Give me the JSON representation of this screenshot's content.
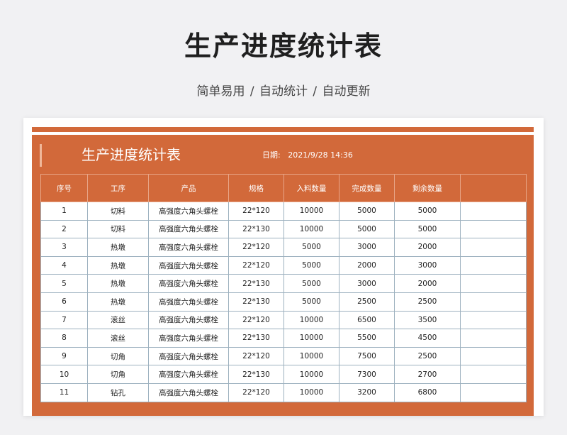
{
  "header": {
    "title": "生产进度统计表",
    "subtitle": "简单易用  /  自动统计  /  自动更新"
  },
  "sheet": {
    "title": "生产进度统计表",
    "date_label": "日期:",
    "date_value": "2021/9/28 14:36",
    "colors": {
      "frame": "#d2693a",
      "grid": "#9db1bf"
    }
  },
  "table": {
    "columns": [
      "序号",
      "工序",
      "产品",
      "规格",
      "入料数量",
      "完成数量",
      "剩余数量",
      ""
    ],
    "rows": [
      [
        "1",
        "切料",
        "高强度六角头螺栓",
        "22*120",
        "10000",
        "5000",
        "5000",
        ""
      ],
      [
        "2",
        "切料",
        "高强度六角头螺栓",
        "22*130",
        "10000",
        "5000",
        "5000",
        ""
      ],
      [
        "3",
        "热墩",
        "高强度六角头螺栓",
        "22*120",
        "5000",
        "3000",
        "2000",
        ""
      ],
      [
        "4",
        "热墩",
        "高强度六角头螺栓",
        "22*120",
        "5000",
        "2000",
        "3000",
        ""
      ],
      [
        "5",
        "热墩",
        "高强度六角头螺栓",
        "22*130",
        "5000",
        "3000",
        "2000",
        ""
      ],
      [
        "6",
        "热墩",
        "高强度六角头螺栓",
        "22*130",
        "5000",
        "2500",
        "2500",
        ""
      ],
      [
        "7",
        "滚丝",
        "高强度六角头螺栓",
        "22*120",
        "10000",
        "6500",
        "3500",
        ""
      ],
      [
        "8",
        "滚丝",
        "高强度六角头螺栓",
        "22*130",
        "10000",
        "5500",
        "4500",
        ""
      ],
      [
        "9",
        "切角",
        "高强度六角头螺栓",
        "22*120",
        "10000",
        "7500",
        "2500",
        ""
      ],
      [
        "10",
        "切角",
        "高强度六角头螺栓",
        "22*130",
        "10000",
        "7300",
        "2700",
        ""
      ],
      [
        "11",
        "钻孔",
        "高强度六角头螺栓",
        "22*120",
        "10000",
        "3200",
        "6800",
        ""
      ]
    ]
  }
}
